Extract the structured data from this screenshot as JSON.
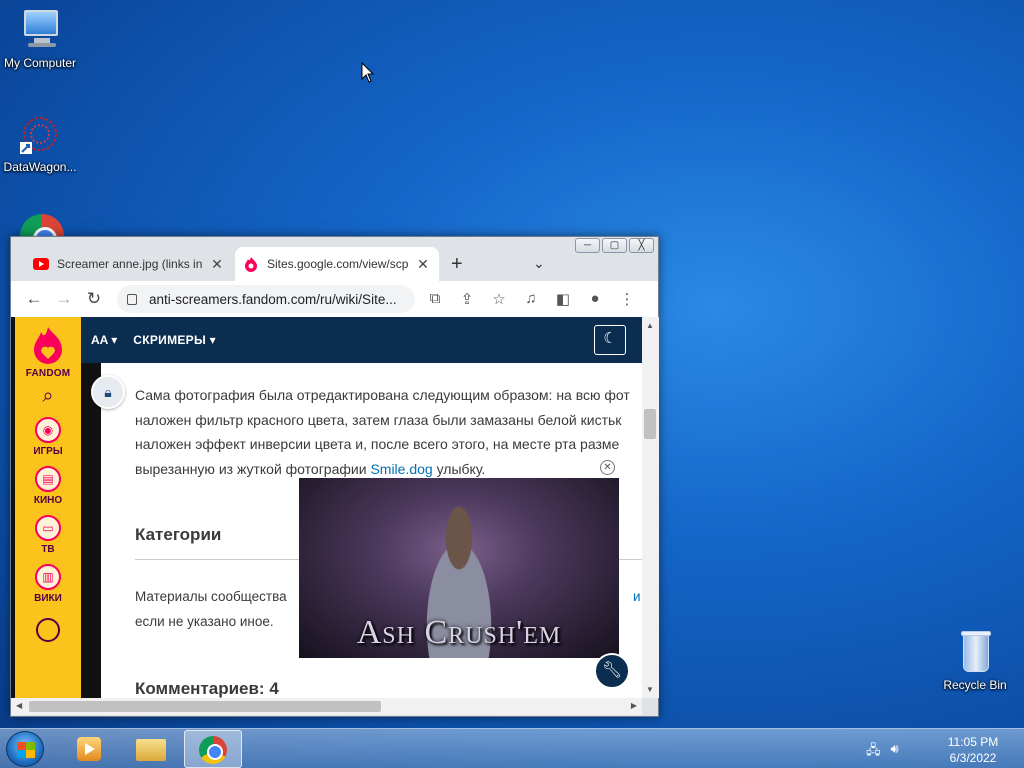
{
  "desktop": {
    "icons": [
      {
        "label": "My Computer"
      },
      {
        "label": "DataWagon..."
      },
      {
        "label": "Recycle Bin"
      }
    ]
  },
  "browser": {
    "window_controls": {
      "minimize": "─",
      "maximize": "▢",
      "close": "╳"
    },
    "tabs": [
      {
        "title": "Screamer anne.jpg (links in",
        "close": "✕",
        "favicon": "youtube-icon",
        "active": false
      },
      {
        "title": "Sites.google.com/view/scp",
        "close": "✕",
        "favicon": "fandom-icon",
        "active": true
      }
    ],
    "new_tab": "+",
    "tab_menu": "⌄",
    "nav": {
      "back": "←",
      "forward": "→",
      "reload": "↻"
    },
    "url": "anti-screamers.fandom.com/ru/wiki/Site...",
    "toolbar_icons": [
      "translate-icon",
      "share-icon",
      "star-icon",
      "media-icon",
      "sidepanel-icon",
      "profile-icon",
      "menu-icon"
    ]
  },
  "fandom": {
    "brand": "FANDOM",
    "sidebar": [
      {
        "label": "ИГРЫ",
        "icon": "gamepad-icon"
      },
      {
        "label": "КИНО",
        "icon": "film-icon"
      },
      {
        "label": "ТВ",
        "icon": "tv-icon"
      },
      {
        "label": "ВИКИ",
        "icon": "book-icon"
      }
    ],
    "topnav": {
      "wiki_short": "AA ▾",
      "section": "СКРИМЕРЫ ▾"
    },
    "article_lines": [
      "Сама фотография была отредактирована следующим образом: на всю фот",
      "наложен фильтр красного цвета, затем глаза были замазаны белой кистьк",
      "наложен эффект инверсии цвета и, после всего этого, на месте рта разме"
    ],
    "article_last_pre": "вырезанную из жуткой фотографии ",
    "article_link": "Smile.dog",
    "article_last_post": " улыбку.",
    "categories_heading": "Категории",
    "license_line1": "Материалы сообщества",
    "license_line1_tail": "и С",
    "license_line2": "если не указано иное.",
    "comments_heading": "Комментариев: 4",
    "video_caption": "Ash Crush'em",
    "video_close": "✕"
  },
  "taskbar": {
    "time": "11:05 PM",
    "date": "6/3/2022"
  }
}
